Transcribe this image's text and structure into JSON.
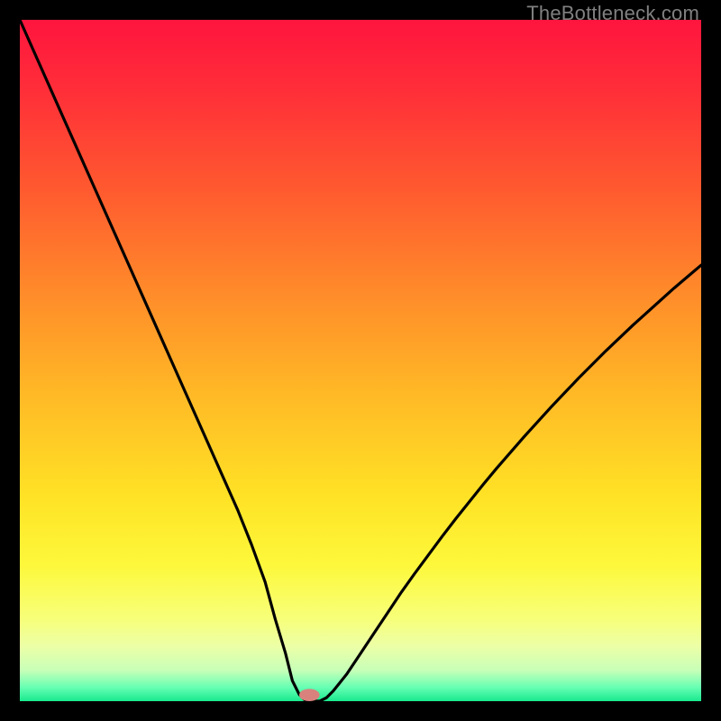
{
  "watermark": "TheBottleneck.com",
  "gradient_stops": [
    {
      "pos": 0.0,
      "color": "#ff153e"
    },
    {
      "pos": 0.1,
      "color": "#ff2d39"
    },
    {
      "pos": 0.25,
      "color": "#ff5a2f"
    },
    {
      "pos": 0.4,
      "color": "#ff8b2a"
    },
    {
      "pos": 0.55,
      "color": "#ffb926"
    },
    {
      "pos": 0.7,
      "color": "#ffe225"
    },
    {
      "pos": 0.8,
      "color": "#fdf83b"
    },
    {
      "pos": 0.88,
      "color": "#f7ff7a"
    },
    {
      "pos": 0.92,
      "color": "#ecffa7"
    },
    {
      "pos": 0.955,
      "color": "#c7ffb8"
    },
    {
      "pos": 0.98,
      "color": "#66ffb3"
    },
    {
      "pos": 1.0,
      "color": "#19e98e"
    }
  ],
  "marker": {
    "x_frac": 0.425,
    "color": "#d9827d"
  },
  "chart_data": {
    "type": "line",
    "title": "",
    "xlabel": "",
    "ylabel": "",
    "xlim": [
      0,
      100
    ],
    "ylim": [
      0,
      100
    ],
    "x": [
      0,
      2,
      4,
      6,
      8,
      10,
      12,
      14,
      16,
      18,
      20,
      22,
      24,
      26,
      28,
      30,
      32,
      34,
      36,
      37.5,
      39,
      40,
      41,
      42,
      43,
      44,
      45,
      46,
      48,
      50,
      52,
      54,
      56,
      58,
      60,
      62,
      64,
      66,
      68,
      70,
      72,
      74,
      76,
      78,
      80,
      82,
      84,
      86,
      88,
      90,
      92,
      94,
      96,
      98,
      100
    ],
    "values": [
      100,
      95.5,
      91,
      86.5,
      82,
      77.5,
      73,
      68.5,
      64,
      59.5,
      55,
      50.5,
      46,
      41.5,
      37,
      32.5,
      28,
      23,
      17.5,
      12,
      7,
      3,
      1,
      0,
      0,
      0,
      0.5,
      1.5,
      4,
      7,
      10,
      13,
      16,
      18.8,
      21.5,
      24.2,
      26.8,
      29.3,
      31.8,
      34.2,
      36.5,
      38.8,
      41,
      43.2,
      45.3,
      47.4,
      49.4,
      51.4,
      53.3,
      55.2,
      57,
      58.8,
      60.6,
      62.3,
      64
    ]
  }
}
